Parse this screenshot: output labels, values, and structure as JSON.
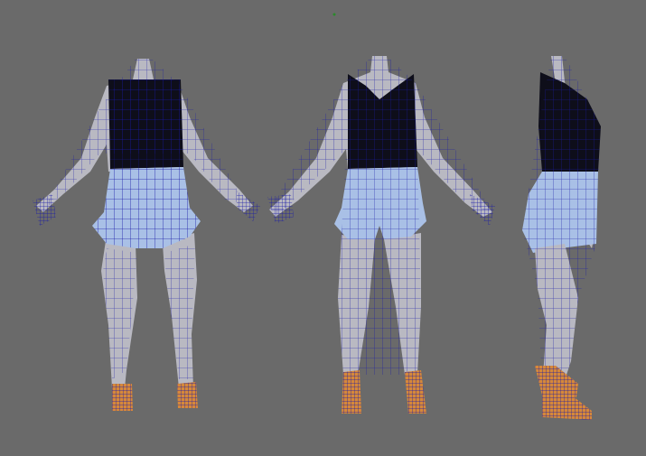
{
  "viewport": {
    "background_color": "#6a6a6a",
    "views": [
      "back",
      "front",
      "side"
    ]
  },
  "materials": {
    "skin_color": "#b9b9c2",
    "top_color": "#0e0e1a",
    "shorts_color": "#a9c0e6",
    "shoes_color": "#d6883a",
    "wireframe_color": "#1a1aa8"
  }
}
